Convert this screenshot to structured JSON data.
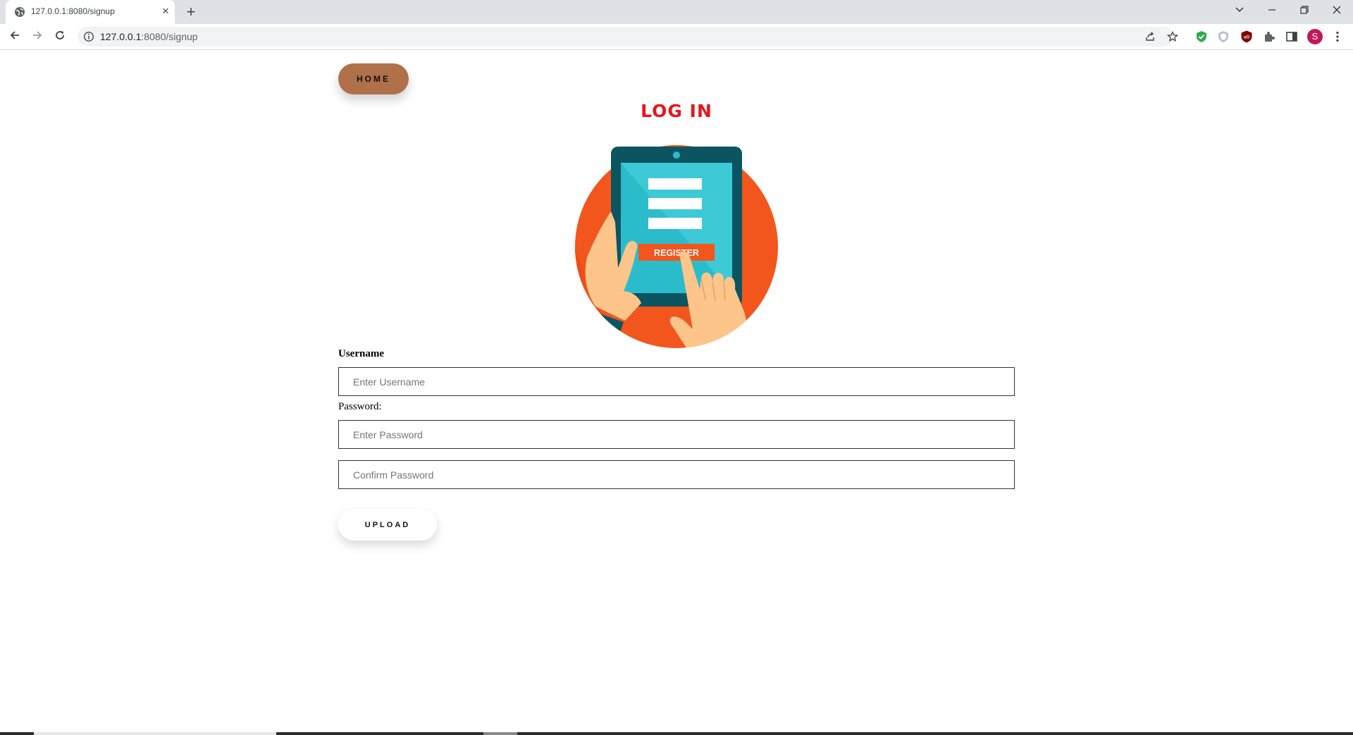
{
  "browser": {
    "tab_title": "127.0.0.1:8080/signup",
    "new_tab_symbol": "+",
    "close_symbol": "×",
    "url_host": "127.0.0.1",
    "url_path": ":8080/signup",
    "profile_initial": "S",
    "icons": [
      "back-icon",
      "forward-icon",
      "reload-icon",
      "info-icon",
      "share-icon",
      "star-icon",
      "shield-extension-icon",
      "privacy-extension-icon",
      "ublock-icon",
      "puzzle-extension-icon",
      "side-panel-icon",
      "profile-avatar",
      "more-menu-icon",
      "tab-search-icon",
      "minimize-icon",
      "restore-icon",
      "close-window-icon"
    ]
  },
  "page": {
    "home_label": "HOME",
    "title": "LOG IN",
    "illustration_button_text": "REGISTER",
    "username_label": "Username",
    "username_placeholder": "Enter Username",
    "password_label": "Password:",
    "password_placeholder": "Enter Password",
    "confirm_placeholder": "Confirm Password",
    "upload_label": "UPLOAD"
  },
  "colors": {
    "home_button": "#b07049",
    "title": "#e8151b",
    "illustration_circle": "#f2561d",
    "tablet_frame": "#0b5560",
    "tablet_screen": "#2bbccc"
  }
}
